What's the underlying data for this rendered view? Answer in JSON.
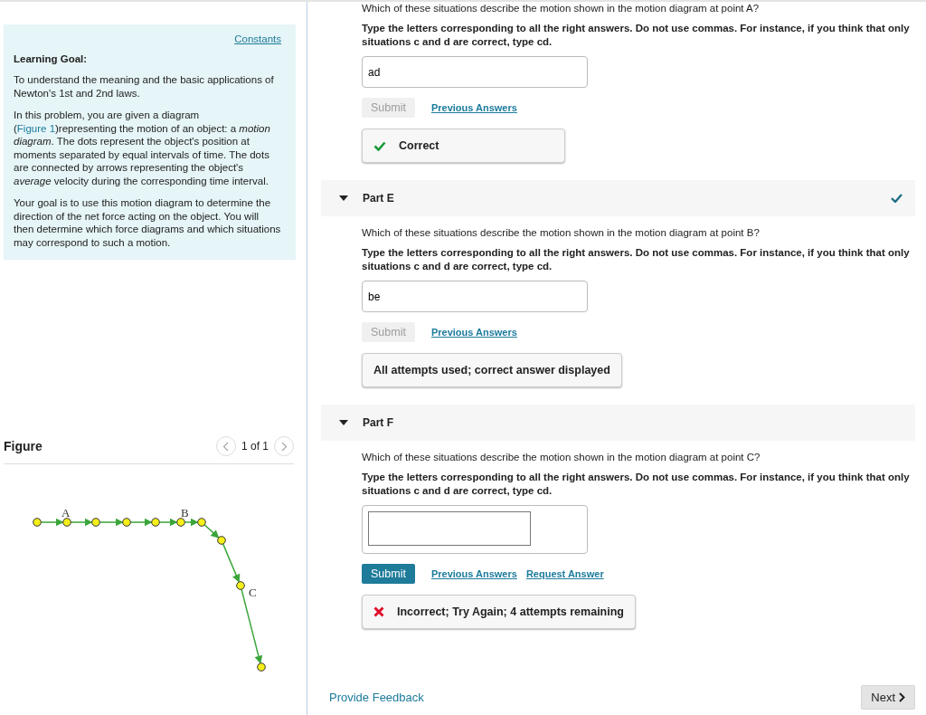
{
  "intro": {
    "constants_link": "Constants",
    "heading": "Learning Goal:",
    "paragraphs": [
      [
        {
          "kind": "text",
          "text": "To understand the meaning and the basic applications of Newton's 1st and 2nd laws."
        }
      ],
      [
        {
          "kind": "text",
          "text": "In this problem, you are given a diagram ("
        },
        {
          "kind": "link",
          "text": "Figure 1"
        },
        {
          "kind": "text",
          "text": ")representing the motion of an object: a *motion diagram*. The dots represent the object's position at moments separated by equal intervals of time. The dots are connected by arrows representing the object's *average* velocity during the corresponding time interval."
        }
      ],
      [
        {
          "kind": "text",
          "text": "Your goal is to use this motion diagram to determine the direction of the net force acting on the object. You will then determine which force diagrams and which situations may correspond to such a motion."
        }
      ]
    ]
  },
  "figure": {
    "title": "Figure",
    "pager": "1 of 1",
    "labels": [
      "A",
      "B",
      "C"
    ]
  },
  "parts": [
    {
      "question": "Which of these situations describe the motion shown in the motion diagram at point A?",
      "instruction": "Type the letters corresponding to all the right answers. Do not use commas. For instance, if you think that only situations c and d are correct, type cd.",
      "answer": "ad",
      "submit": {
        "label": "Submit",
        "disabled": true
      },
      "links": [
        "Previous Answers"
      ],
      "feedback": {
        "kind": "correct",
        "text": "Correct"
      }
    },
    {
      "title": "Part E",
      "expanded": true,
      "completed": true,
      "question": "Which of these situations describe the motion shown in the motion diagram at point B?",
      "instruction": "Type the letters corresponding to all the right answers. Do not use commas. For instance, if you think that only situations c and d are correct, type cd.",
      "answer": "be",
      "submit": {
        "label": "Submit",
        "disabled": true
      },
      "links": [
        "Previous Answers"
      ],
      "feedback": {
        "kind": "info",
        "text": "All attempts used; correct answer displayed"
      }
    },
    {
      "title": "Part F",
      "expanded": true,
      "completed": false,
      "question": "Which of these situations describe the motion shown in the motion diagram at point C?",
      "instruction": "Type the letters corresponding to all the right answers. Do not use commas. For instance, if you think that only situations c and d are correct, type cd.",
      "submit": {
        "label": "Submit",
        "disabled": false
      },
      "links": [
        "Previous Answers",
        "Request Answer"
      ],
      "feedback": {
        "kind": "incorrect",
        "text": "Incorrect; Try Again; 4 attempts remaining"
      }
    }
  ],
  "footer": {
    "feedback_link": "Provide Feedback",
    "next_button": "Next"
  }
}
